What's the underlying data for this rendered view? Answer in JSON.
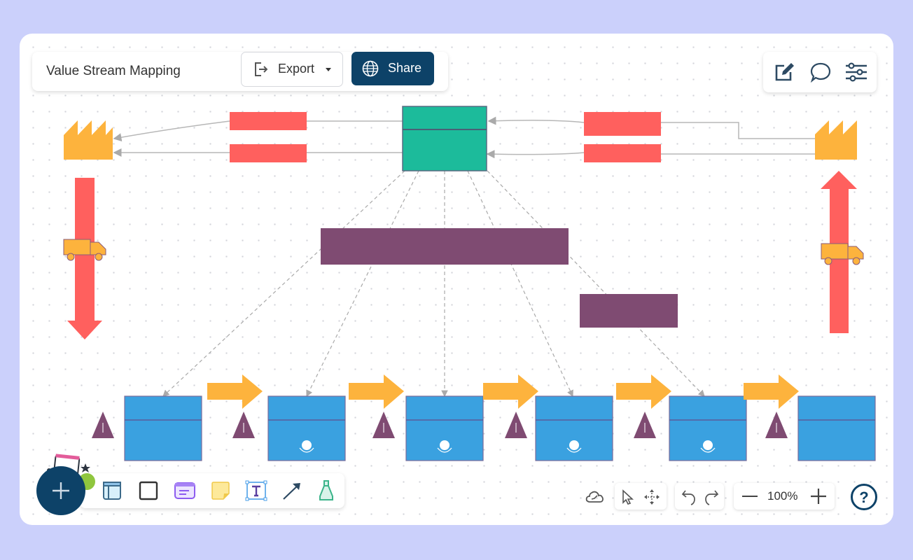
{
  "header": {
    "title": "Value Stream Mapping",
    "export_label": "Export",
    "share_label": "Share"
  },
  "right_tools": [
    "edit-icon",
    "comment-icon",
    "settings-sliders-icon"
  ],
  "bottom_toolbar": {
    "tools": [
      "add",
      "container",
      "rectangle",
      "card",
      "sticky-note",
      "text",
      "arrow",
      "pen"
    ]
  },
  "view_controls": {
    "zoom_label": "100%"
  },
  "diagram": {
    "colors": {
      "factory": "#fdb33d",
      "kanban": "#ff605e",
      "control": "#1cbb9b",
      "info_bar": "#7f4b72",
      "process": "#3aa1e0",
      "push_arrow": "#fdb33d",
      "inventory": "#7f4b72",
      "connector": "#b4b4b4"
    },
    "process_boxes": 6,
    "inventory_triangles": 6,
    "push_arrows": 5
  }
}
